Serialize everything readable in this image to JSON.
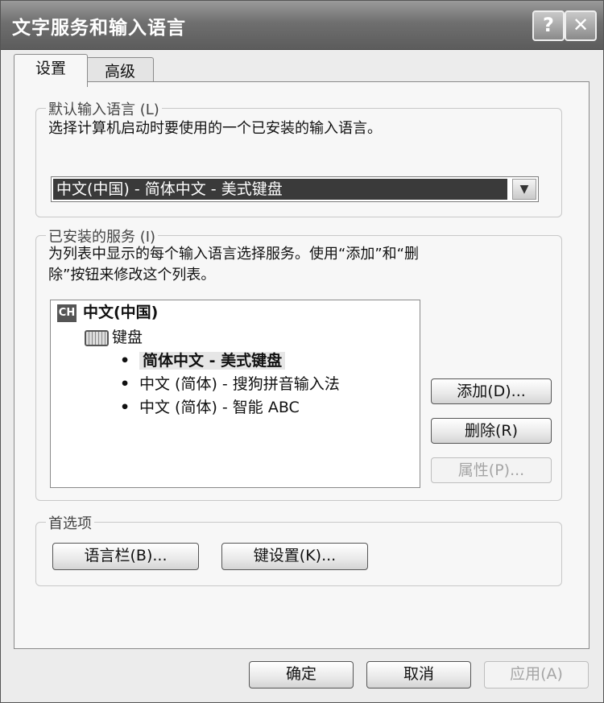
{
  "window": {
    "title": "文字服务和输入语言",
    "help_glyph": "?",
    "close_glyph": "✕"
  },
  "tabs": [
    {
      "label": "设置",
      "selected": true
    },
    {
      "label": "高级",
      "selected": false
    }
  ],
  "default_language": {
    "legend": "默认输入语言 (L)",
    "description": "选择计算机启动时要使用的一个已安装的输入语言。",
    "selected": "中文(中国) - 简体中文 - 美式键盘",
    "arrow_glyph": "▼"
  },
  "installed_services": {
    "legend": "已安装的服务 (I)",
    "description_line1": "为列表中显示的每个输入语言选择服务。使用“添加”和“删",
    "description_line2": "除”按钮来修改这个列表。",
    "language_badge": "CH",
    "language": "中文(中国)",
    "category": "键盘",
    "bullet": "•",
    "items": [
      {
        "label": "简体中文 - 美式键盘",
        "selected": true
      },
      {
        "label": "中文 (简体) - 搜狗拼音输入法",
        "selected": false
      },
      {
        "label": "中文 (简体) - 智能 ABC",
        "selected": false
      }
    ],
    "add_label": "添加(D)...",
    "remove_label": "删除(R)",
    "properties_label": "属性(P)..."
  },
  "preferences": {
    "legend": "首选项",
    "language_bar_label": "语言栏(B)...",
    "key_settings_label": "键设置(K)..."
  },
  "footer": {
    "ok_label": "确定",
    "cancel_label": "取消",
    "apply_label": "应用(A)"
  },
  "colors": {
    "titlebar": "#6f6f6f",
    "selection": "#3a3a3a",
    "disabled_text": "#a5a5a5"
  }
}
